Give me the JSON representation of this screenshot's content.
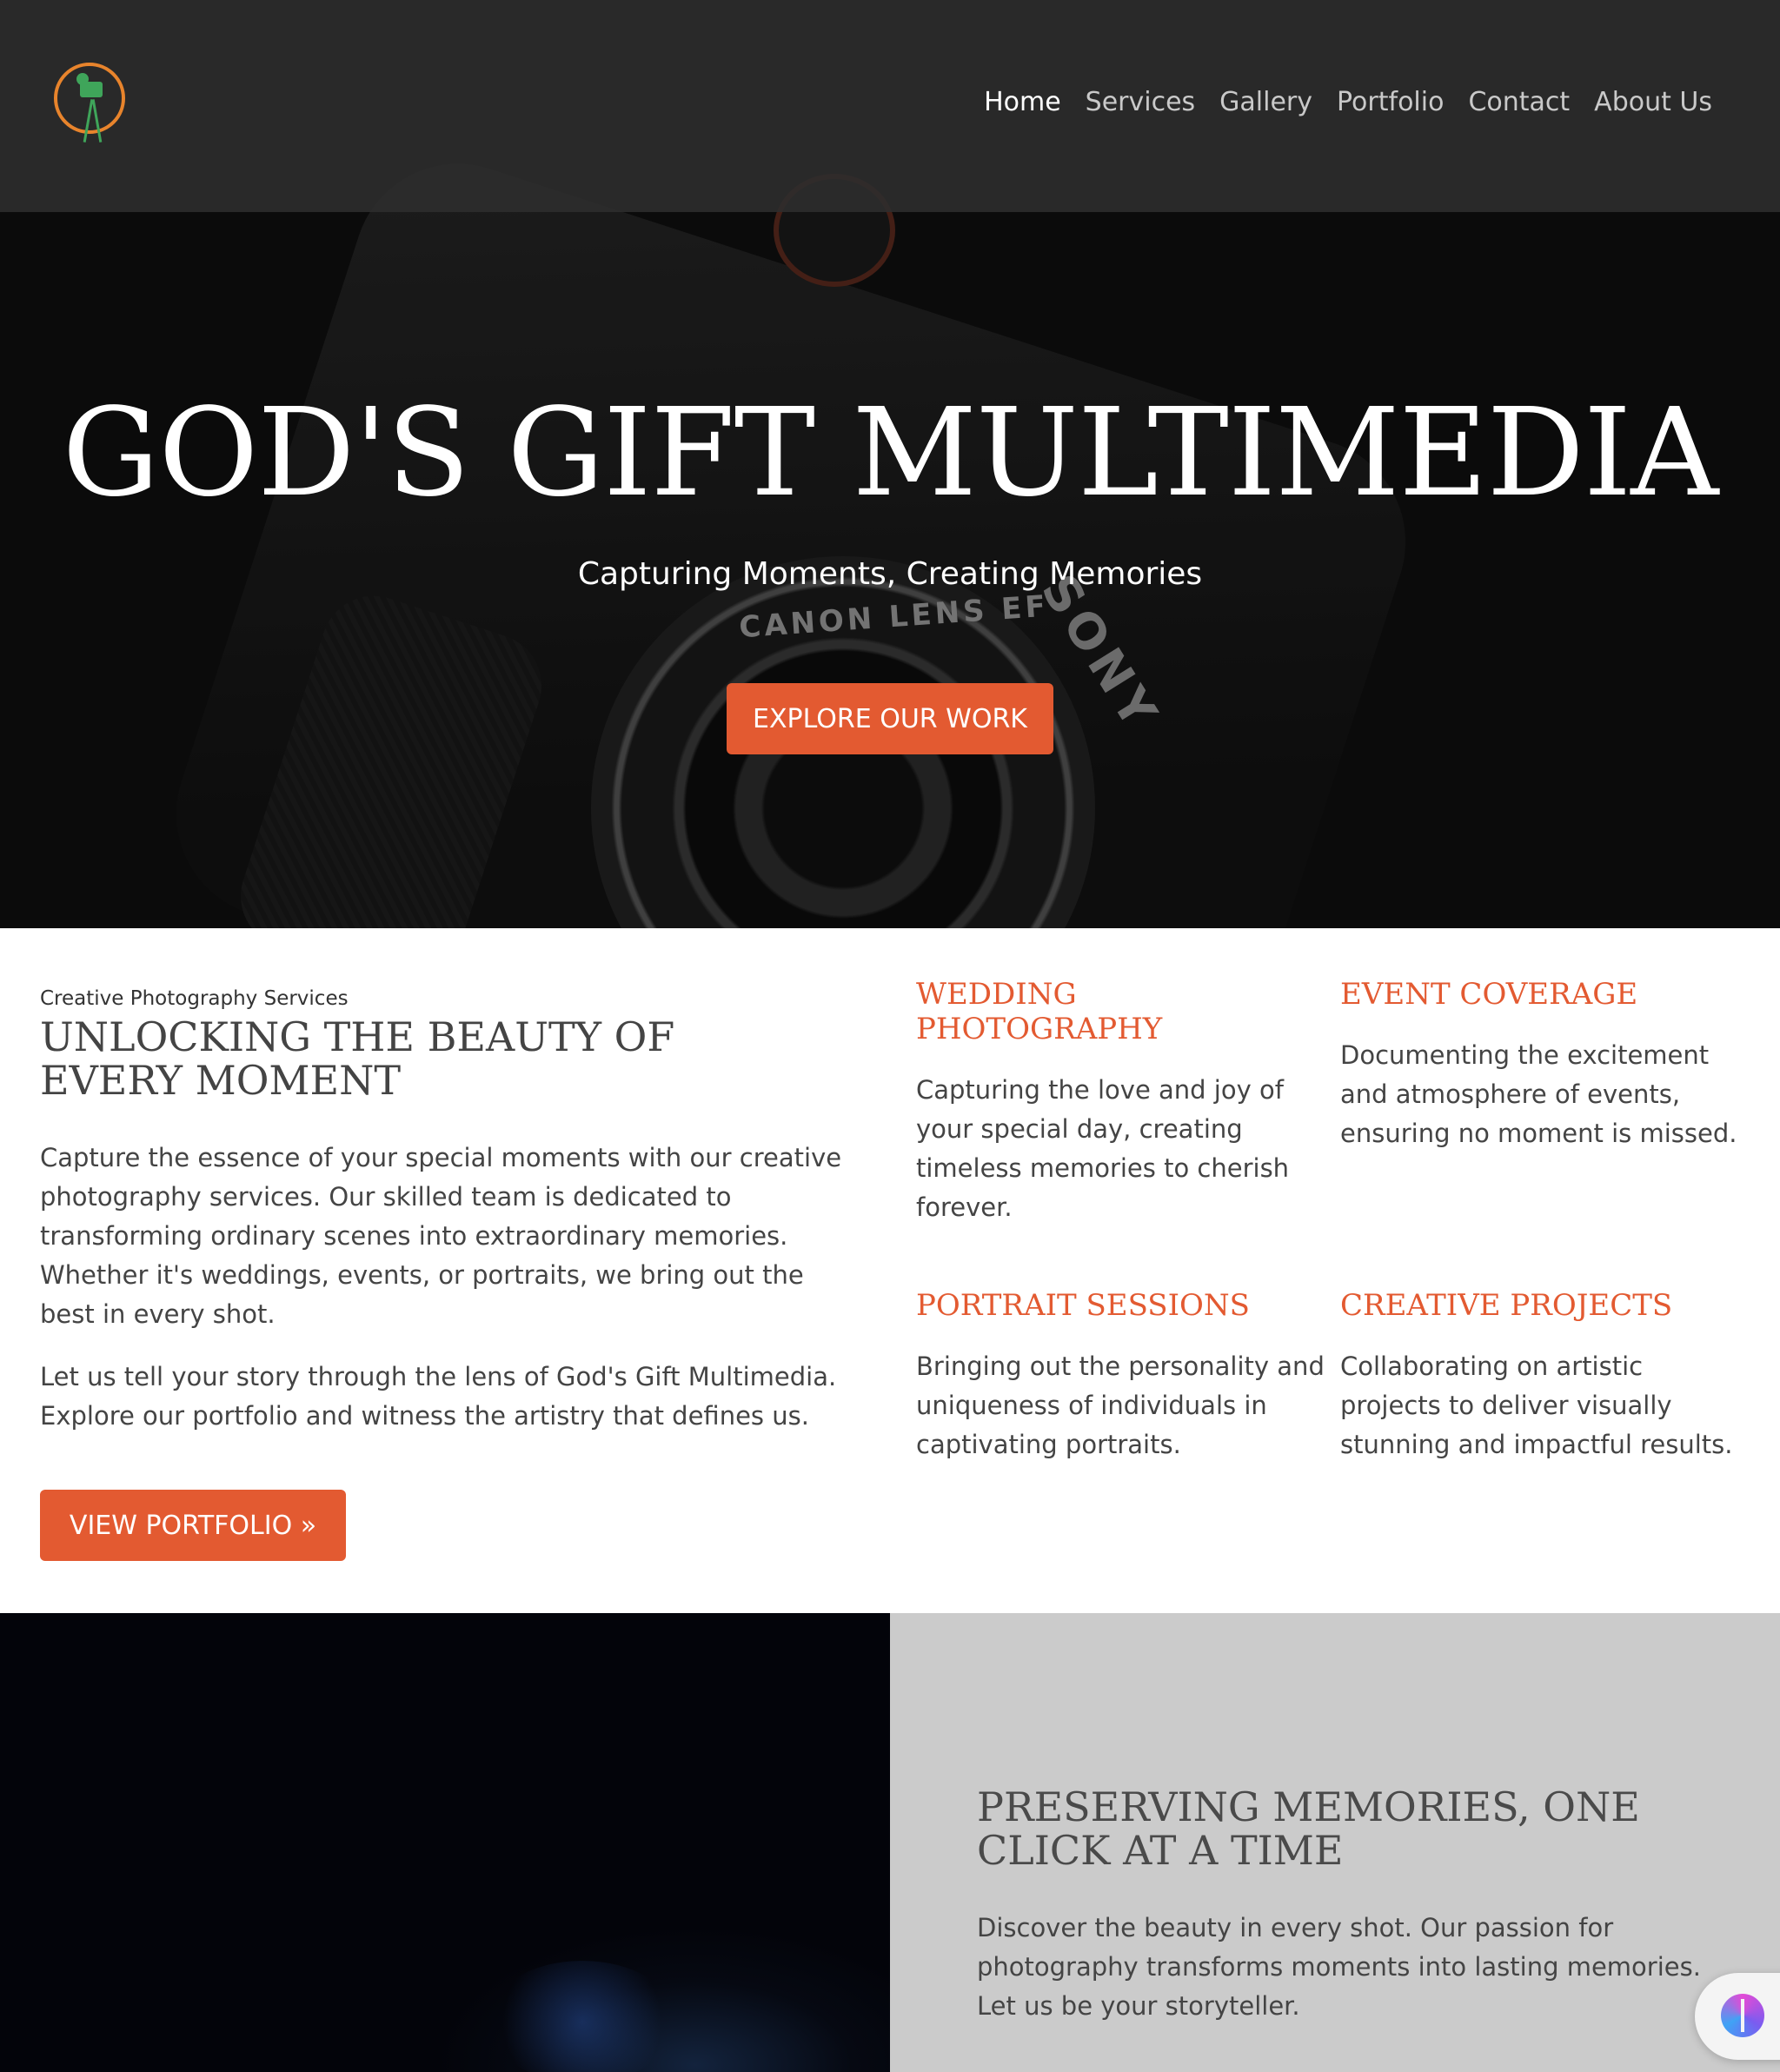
{
  "nav": {
    "items": [
      {
        "label": "Home",
        "active": true
      },
      {
        "label": "Services",
        "active": false
      },
      {
        "label": "Gallery",
        "active": false
      },
      {
        "label": "Portfolio",
        "active": false
      },
      {
        "label": "Contact",
        "active": false
      },
      {
        "label": "About Us",
        "active": false
      }
    ],
    "logo_icon": "camera-tripod-logo-icon"
  },
  "hero": {
    "title": "GOD'S GIFT MULTIMEDIA",
    "subtitle": "Capturing Moments, Creating Memories",
    "button_label": "EXPLORE OUR WORK",
    "background_text": {
      "lens": "CANON LENS EF",
      "brand": "SONY"
    }
  },
  "about": {
    "eyebrow": "Creative Photography Services",
    "title": "UNLOCKING THE BEAUTY OF EVERY MOMENT",
    "paragraph1": "Capture the essence of your special moments with our creative photography services. Our skilled team is dedicated to transforming ordinary scenes into extraordinary memories. Whether it's weddings, events, or portraits, we bring out the best in every shot.",
    "paragraph2": "Let us tell your story through the lens of God's Gift Multimedia. Explore our portfolio and witness the artistry that defines us.",
    "button_label": "VIEW PORTFOLIO »"
  },
  "services": [
    {
      "title": "WEDDING PHOTOGRAPHY",
      "text": "Capturing the love and joy of your special day, creating timeless memories to cherish forever."
    },
    {
      "title": "EVENT COVERAGE",
      "text": "Documenting the excitement and atmosphere of events, ensuring no moment is missed."
    },
    {
      "title": "PORTRAIT SESSIONS",
      "text": "Bringing out the personality and uniqueness of individuals in captivating portraits."
    },
    {
      "title": "CREATIVE PROJECTS",
      "text": "Collaborating on artistic projects to deliver visually stunning and impactful results."
    }
  ],
  "preserve": {
    "title": "PRESERVING MEMORIES, ONE CLICK AT A TIME",
    "text": "Discover the beauty in every shot. Our passion for photography transforms moments into lasting memories. Let us be your storyteller."
  },
  "colors": {
    "accent": "#e35a31",
    "nav_bg": "#2d2d2d",
    "logo_ring": "#e8842c",
    "logo_green": "#3fa55a"
  },
  "assistant_icon": "brain-icon"
}
